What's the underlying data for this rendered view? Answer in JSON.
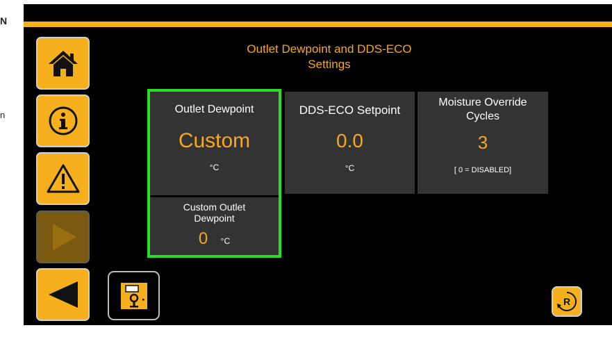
{
  "page_fragments": {
    "frag_n": "N",
    "frag_n2": "n"
  },
  "header": {
    "title_line1": "Outlet Dewpoint and DDS-ECO",
    "title_line2": "Settings"
  },
  "nav": {
    "home_icon": "home-icon",
    "info_icon": "info-icon",
    "warning_icon": "warning-icon",
    "next_icon": "play-icon",
    "back_icon": "back-arrow-icon"
  },
  "panels": {
    "outlet_dewpoint": {
      "label": "Outlet Dewpoint",
      "value": "Custom",
      "unit": "°C"
    },
    "dds_eco_setpoint": {
      "label": "DDS-ECO Setpoint",
      "value": "0.0",
      "unit": "°C"
    },
    "moisture_override": {
      "label_line1": "Moisture Override",
      "label_line2": "Cycles",
      "value": "3",
      "note": "[ 0 = DISABLED]"
    },
    "custom_outlet_dewpoint": {
      "label_line1": "Custom Outlet",
      "label_line2": "Dewpoint",
      "value": "0",
      "unit": "°C"
    }
  },
  "footer": {
    "save_icon": "save-icon",
    "reset_label": "R"
  },
  "colors": {
    "accent": "#F7B01D",
    "value_text": "#F7A81B",
    "selected_border": "#28E021",
    "panel_bg": "#333333",
    "screen_bg": "#000000"
  }
}
